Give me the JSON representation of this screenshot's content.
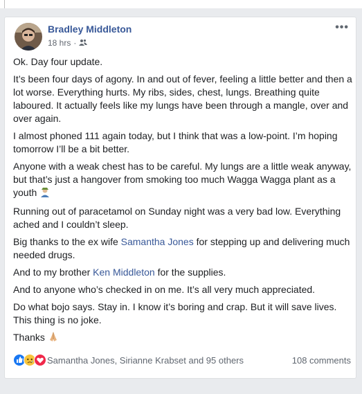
{
  "post": {
    "author": "Bradley Middleton",
    "time": "18 hrs",
    "dot": "·",
    "privacy_icon": "friends-icon",
    "more_icon": "more-options-icon",
    "more_glyph": "•••",
    "paragraphs": {
      "p1": "Ok. Day four update.",
      "p2": "It’s been four days of agony. In and out of fever, feeling a little better and then a lot worse. Everything hurts. My ribs, sides, chest, lungs. Breathing quite laboured. It actually feels like my lungs have been through a mangle, over and over again.",
      "p3": "I almost phoned 111 again today, but I think that was a low-point. I’m hoping tomorrow I’ll be a bit better.",
      "p4": "Anyone with a weak chest has to be careful. My lungs are a little weak anyway, but that’s just a hangover from smoking too much Wagga Wagga plant as a youth",
      "p5": "Running out of paracetamol on Sunday night was a very bad low. Everything ached and I couldn’t sleep.",
      "p6_before": "Big thanks to the ex wife ",
      "p6_link": "Samantha Jones",
      "p6_after": " for stepping up and delivering much needed drugs.",
      "p7_before": "And to my brother ",
      "p7_link": "Ken Middleton",
      "p7_after": " for the supplies.",
      "p8": "And to anyone who’s checked in on me. It’s all very much appreciated.",
      "p9": "Do what bojo says. Stay in. I know it’s boring and crap. But it will save lives. This thing is no joke.",
      "p10": "Thanks"
    },
    "reactions": [
      "like-icon",
      "sad-icon",
      "love-icon"
    ],
    "reactors": "Samantha Jones, Sirianne Krabset and 95 others",
    "comments": "108 comments"
  }
}
